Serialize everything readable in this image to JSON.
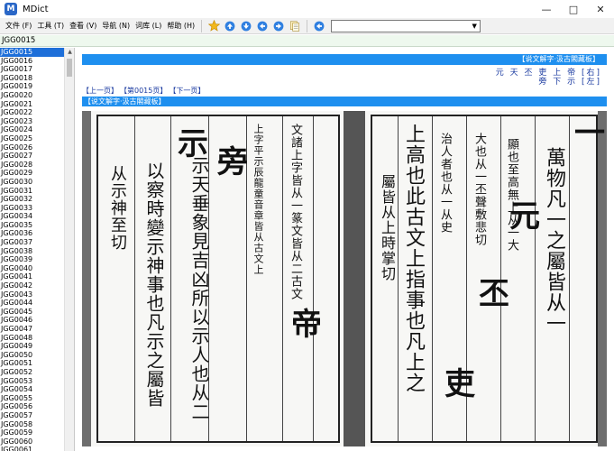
{
  "window": {
    "title": "MDict",
    "icon_letter": "M"
  },
  "menu": [
    "文件 (F)",
    "工具 (T)",
    "查看 (V)",
    "导航 (N)",
    "词库 (L)",
    "帮助 (H)"
  ],
  "toolbar_icons": [
    "star-icon",
    "up-arrow-icon",
    "down-arrow-icon",
    "back-icon",
    "forward-icon",
    "copy-icon",
    "search-go-icon"
  ],
  "search": {
    "value": ""
  },
  "current_entry": "JGG0015",
  "entries": [
    "JGG0015",
    "JGG0016",
    "JGG0017",
    "JGG0018",
    "JGG0019",
    "JGG0020",
    "JGG0021",
    "JGG0022",
    "JGG0023",
    "JGG0024",
    "JGG0025",
    "JGG0026",
    "JGG0027",
    "JGG0028",
    "JGG0029",
    "JGG0030",
    "JGG0031",
    "JGG0032",
    "JGG0033",
    "JGG0034",
    "JGG0035",
    "JGG0036",
    "JGG0037",
    "JGG0038",
    "JGG0039",
    "JGG0040",
    "JGG0041",
    "JGG0042",
    "JGG0043",
    "JGG0044",
    "JGG0045",
    "JGG0046",
    "JGG0047",
    "JGG0048",
    "JGG0049",
    "JGG0050",
    "JGG0051",
    "JGG0052",
    "JGG0053",
    "JGG0054",
    "JGG0055",
    "JGG0056",
    "JGG0057",
    "JGG0058",
    "JGG0059",
    "JGG0060",
    "JGG0061"
  ],
  "selected_index": 0,
  "dict": {
    "banner_title": "【说文解字·汲古閣藏板】",
    "nav_row1": "元 天 丕 吏 上 帝 [右]",
    "nav_row2": "旁 下 示 [左]",
    "prev_page": "【上一页】",
    "current_page": "【第0015页】",
    "next_page": "【下一页】",
    "banner2_title": "【说文解字·汲古閣藏板】"
  },
  "scan_text": {
    "right_page_cols": [
      "萬物凡一之屬皆从一",
      "顯也至高無上从一大",
      "大也从一丕聲敷悲切",
      "治人者也从一从史",
      "上高也此古文上指事也凡上之",
      "屬皆从上時掌切"
    ],
    "left_page_cols": [
      "文諸上字皆从一篆文皆从二古文",
      "上字平示辰龍童音章皆从古文上",
      "示天垂象見吉凶所以示人也从二",
      "以察時變示神事也凡示之屬皆",
      "从示神至切"
    ],
    "right_seals": [
      "一",
      "元",
      "丕",
      "吏"
    ],
    "left_seals": [
      "帝",
      "旁",
      "示"
    ]
  }
}
